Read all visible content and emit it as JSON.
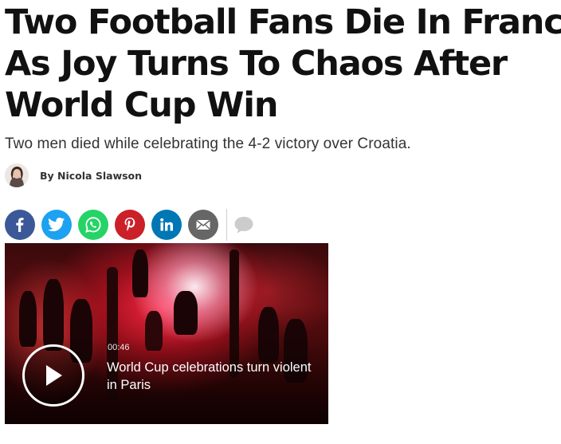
{
  "article": {
    "headline_lines": [
      "Two Football Fans Die In France",
      "As Joy Turns To Chaos After",
      "World Cup Win"
    ],
    "subheadline": "Two men died while celebrating the 4-2 victory over Croatia.",
    "byline": "By Nicola Slawson"
  },
  "share": {
    "buttons": [
      {
        "name": "facebook",
        "icon": "facebook-icon",
        "color": "#3b5998"
      },
      {
        "name": "twitter",
        "icon": "twitter-bird-icon",
        "color": "#1da1f2"
      },
      {
        "name": "whatsapp",
        "icon": "whatsapp-icon",
        "color": "#25d366"
      },
      {
        "name": "pinterest",
        "icon": "pinterest-icon",
        "color": "#cb2027"
      },
      {
        "name": "linkedin",
        "icon": "linkedin-icon",
        "color": "#0077b5"
      },
      {
        "name": "email",
        "icon": "envelope-icon",
        "color": "#666666"
      }
    ],
    "comment_icon": "comment-bubble-icon",
    "comment_color": "#cccccc"
  },
  "video": {
    "duration": "00:46",
    "title": "World Cup celebrations turn violent in Paris",
    "play_icon": "play-icon"
  }
}
